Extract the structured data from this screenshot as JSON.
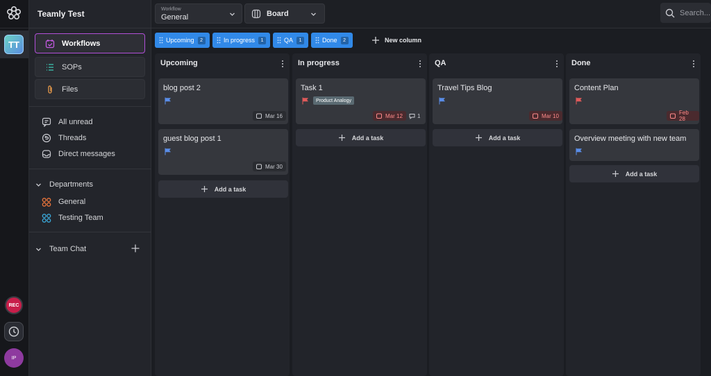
{
  "workspace": {
    "name": "Teamly Test",
    "avatar_initials": "TT"
  },
  "rail": {
    "rec_label": "REC",
    "user_initials": "IP"
  },
  "sidebar": {
    "nav": [
      {
        "label": "Workflows",
        "icon": "calendar-check-icon",
        "active": true
      },
      {
        "label": "SOPs",
        "icon": "list-icon",
        "active": false
      },
      {
        "label": "Files",
        "icon": "paperclip-icon",
        "active": false
      }
    ],
    "links": [
      {
        "label": "All unread",
        "icon": "chat-bubble-icon"
      },
      {
        "label": "Threads",
        "icon": "thread-icon"
      },
      {
        "label": "Direct messages",
        "icon": "inbox-icon"
      }
    ],
    "departments": {
      "label": "Departments",
      "items": [
        {
          "label": "General",
          "color": "#e8743b"
        },
        {
          "label": "Testing Team",
          "color": "#3aa7d8"
        }
      ]
    },
    "team_chat": {
      "label": "Team Chat"
    }
  },
  "topbar": {
    "workflow_caption": "Workflow",
    "workflow_value": "General",
    "view_value": "Board",
    "search_placeholder": "Search..."
  },
  "chips": [
    {
      "label": "Upcoming",
      "count": "2"
    },
    {
      "label": "In progress",
      "count": "1"
    },
    {
      "label": "QA",
      "count": "1"
    },
    {
      "label": "Done",
      "count": "2"
    }
  ],
  "new_column_label": "New column",
  "add_task_label": "Add a task",
  "columns": [
    {
      "title": "Upcoming",
      "cards": [
        {
          "title": "blog post 2",
          "flag_color": "#5a8de8",
          "date": "Mar 16",
          "date_overdue": false
        },
        {
          "title": "guest blog post 1",
          "flag_color": "#5a8de8",
          "date": "Mar 30",
          "date_overdue": false
        }
      ]
    },
    {
      "title": "In progress",
      "cards": [
        {
          "title": "Task 1",
          "flag_color": "#e05a5a",
          "tag": "Product Analogy",
          "date": "Mar 12",
          "date_overdue": true,
          "comments": "1"
        }
      ]
    },
    {
      "title": "QA",
      "cards": [
        {
          "title": "Travel Tips Blog",
          "flag_color": "#5a8de8",
          "date": "Mar 10",
          "date_overdue": true
        }
      ]
    },
    {
      "title": "Done",
      "cards": [
        {
          "title": "Content Plan",
          "flag_color": "#e05a5a",
          "date": "Feb 28",
          "date_overdue": true
        },
        {
          "title": "Overview meeting with new team",
          "flag_color": "#5a8de8"
        }
      ]
    }
  ],
  "colors": {
    "accent_blue": "#3189e8",
    "active_outline": "#b14fd8",
    "overdue": "#ff8a8a"
  }
}
